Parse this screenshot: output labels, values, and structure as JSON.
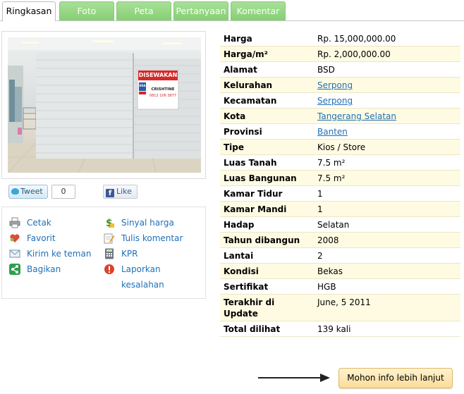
{
  "tabs": [
    {
      "label": "Ringkasan",
      "active": true
    },
    {
      "label": "Foto",
      "active": false
    },
    {
      "label": "Peta",
      "active": false
    },
    {
      "label": "Pertanyaan",
      "active": false
    },
    {
      "label": "Komentar",
      "active": false
    }
  ],
  "photo": {
    "sign_title": "DISEWAKAN",
    "sign_name": "CRISHTINE",
    "sign_phone": "0812 106 3877",
    "sign_logo": "ERA"
  },
  "social": {
    "tweet_label": "Tweet",
    "tweet_count": "0",
    "like_label": "Like"
  },
  "actions": {
    "print": "Cetak",
    "favorite": "Favorit",
    "send_friend": "Kirim ke teman",
    "share": "Bagikan",
    "price_signal": "Sinyal harga",
    "write_comment": "Tulis komentar",
    "kpr": "KPR",
    "report_error_line1": "Laporkan",
    "report_error_line2": "kesalahan"
  },
  "details": [
    {
      "label": "Harga",
      "value": "Rp. 15,000,000.00",
      "link": false
    },
    {
      "label": "Harga/m²",
      "value": "Rp. 2,000,000.00",
      "link": false
    },
    {
      "label": "Alamat",
      "value": "BSD",
      "link": false
    },
    {
      "label": "Kelurahan",
      "value": "Serpong",
      "link": true
    },
    {
      "label": "Kecamatan",
      "value": "Serpong",
      "link": true
    },
    {
      "label": "Kota",
      "value": "Tangerang Selatan",
      "link": true
    },
    {
      "label": "Provinsi",
      "value": "Banten",
      "link": true
    },
    {
      "label": "Tipe",
      "value": "Kios / Store",
      "link": false
    },
    {
      "label": "Luas Tanah",
      "value": "7.5 m²",
      "link": false
    },
    {
      "label": "Luas Bangunan",
      "value": "7.5 m²",
      "link": false
    },
    {
      "label": "Kamar Tidur",
      "value": "1",
      "link": false
    },
    {
      "label": "Kamar Mandi",
      "value": "1",
      "link": false
    },
    {
      "label": "Hadap",
      "value": "Selatan",
      "link": false
    },
    {
      "label": "Tahun dibangun",
      "value": "2008",
      "link": false
    },
    {
      "label": "Lantai",
      "value": "2",
      "link": false
    },
    {
      "label": "Kondisi",
      "value": "Bekas",
      "link": false
    },
    {
      "label": "Sertifikat",
      "value": "HGB",
      "link": false
    },
    {
      "label": "Terakhir di Update",
      "value": "June, 5 2011",
      "link": false
    },
    {
      "label": "Total dilihat",
      "value": "139 kali",
      "link": false
    }
  ],
  "more_button": "Mohon info lebih lanjut",
  "colors": {
    "tab_green": "#86cf72",
    "link_blue": "#1f6fb8",
    "row_alt": "#fffbe3",
    "button_orange": "#fbdc96"
  }
}
